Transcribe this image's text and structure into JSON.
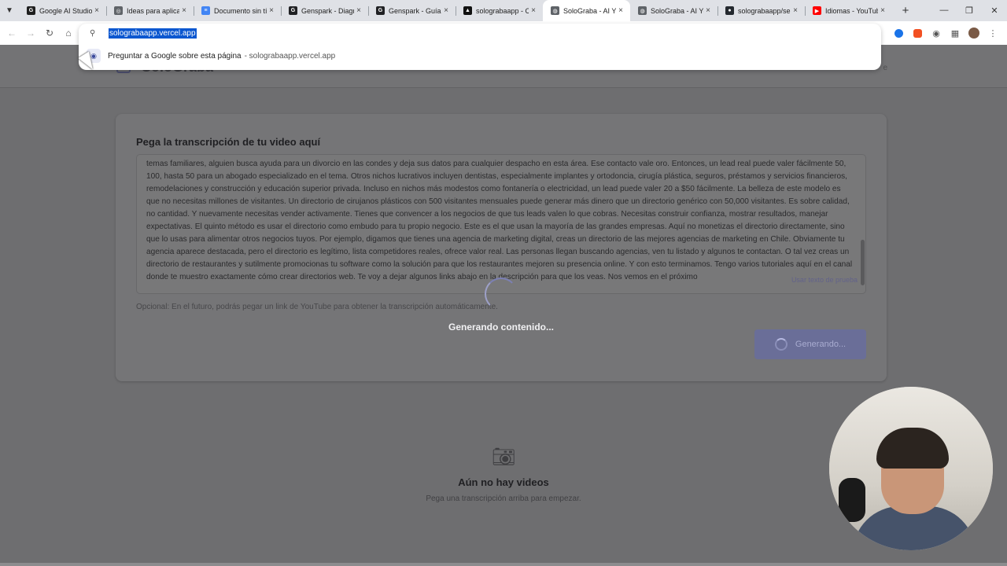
{
  "browser": {
    "tabs": [
      {
        "title": "Google AI Studio",
        "fav_color": "#1f1f1f",
        "fav_glyph": "G"
      },
      {
        "title": "Ideas para aplicac",
        "fav_color": "#5f6368",
        "fav_glyph": "◎"
      },
      {
        "title": "Documento sin tít",
        "fav_color": "#4285f4",
        "fav_glyph": "≡"
      },
      {
        "title": "Genspark - Diagr",
        "fav_color": "#202124",
        "fav_glyph": "G"
      },
      {
        "title": "Genspark - Guía p",
        "fav_color": "#202124",
        "fav_glyph": "G"
      },
      {
        "title": "solograbaapp - C",
        "fav_color": "#111111",
        "fav_glyph": "▲"
      },
      {
        "title": "SoloGraba - AI Yo",
        "fav_color": "#5f6368",
        "fav_glyph": "◍",
        "active": true
      },
      {
        "title": "SoloGraba - AI Yo",
        "fav_color": "#5f6368",
        "fav_glyph": "◍"
      },
      {
        "title": "solograbaapp/ser",
        "fav_color": "#24292f",
        "fav_glyph": "●"
      },
      {
        "title": "Idiomas - YouTub",
        "fav_color": "#ff0000",
        "fav_glyph": "▶"
      }
    ],
    "url": "solograbaapp.vercel.app",
    "suggestion": "Preguntar a Google sobre esta página",
    "suggestion_url": "- solograbaapp.vercel.app"
  },
  "app": {
    "name": "SoloGraba",
    "header_right": "e"
  },
  "form": {
    "title": "Pega la transcripción de tu video aquí",
    "transcript": "temas familiares, alguien busca ayuda para un divorcio en las condes y deja sus datos para cualquier despacho en esta área. Ese contacto vale oro. Entonces, un lead real puede valer fácilmente 50, 100, hasta 50 para un abogado especializado en el tema. Otros nichos lucrativos incluyen dentistas, especialmente implantes y ortodoncia, cirugía plástica, seguros, préstamos y servicios financieros, remodelaciones y construcción y educación superior privada. Incluso en nichos más modestos como fontanería o electricidad, un lead puede valer 20 a $50 fácilmente. La belleza de este modelo es que no necesitas millones de visitantes. Un directorio de cirujanos plásticos con 500 visitantes mensuales puede generar más dinero que un directorio genérico con 50,000 visitantes. Es sobre calidad, no cantidad. Y nuevamente necesitas vender activamente. Tienes que convencer a los negocios de que tus leads valen lo que cobras. Necesitas construir confianza, mostrar resultados, manejar expectativas. El quinto método es usar el directorio como embudo para tu propio negocio. Este es el que usan la mayoría de las grandes empresas. Aquí no monetizas el directorio directamente, sino que lo usas para alimentar otros negocios tuyos. Por ejemplo, digamos que tienes una agencia de marketing digital, creas un directorio de las mejores agencias de marketing en Chile. Obviamente tu agencia aparece destacada, pero el directorio es legítimo, lista competidores reales, ofrece valor real. Las personas llegan buscando agencias, ven tu listado y algunos te contactan. O tal vez creas un directorio de restaurantes y sutilmente promocionas tu software como la solución para que los restaurantes mejoren su presencia online. Y con esto terminamos. Tengo varios tutoriales aquí en el canal donde te muestro exactamente cómo crear directorios web. Te voy a dejar algunos links abajo en la descripción para que los veas. Nos vemos en el próximo",
    "sample_link": "Usar texto de prueba",
    "hint": "Opcional: En el futuro, podrás pegar un link de YouTube para obtener la transcripción automáticamente.",
    "generate_label": "Generando..."
  },
  "empty": {
    "title": "Aún no hay videos",
    "subtitle": "Pega una transcripción arriba para empezar."
  },
  "overlay": {
    "loading_text": "Generando contenido..."
  },
  "icons": {
    "menu": "chevron-down-icon",
    "back": "back-arrow-icon",
    "forward": "forward-arrow-icon",
    "reload": "reload-icon",
    "home": "home-icon",
    "camera": "camera-icon"
  }
}
